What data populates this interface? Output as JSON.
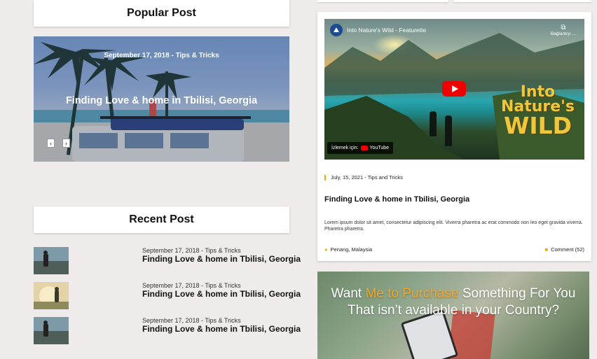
{
  "popular": {
    "heading": "Popular Post",
    "slide": {
      "meta": "September 17, 2018 - Tips & Tricks",
      "title": "Finding Love & home in Tbilisi, Georgia",
      "prev": "‹",
      "next": "›"
    }
  },
  "recent": {
    "heading": "Recent Post",
    "items": [
      {
        "meta": "September 17, 2018 - Tips & Tricks",
        "title": "Finding Love & home in Tbilisi, Georgia"
      },
      {
        "meta": "September 17, 2018 - Tips & Tricks",
        "title": "Finding Love & home in Tbilisi, Georgia"
      },
      {
        "meta": "September 17, 2018 - Tips & Tricks",
        "title": "Finding Love & home in Tbilisi, Georgia"
      }
    ]
  },
  "video_card": {
    "video": {
      "title": "Into Nature's Wild - Featurette",
      "share_label": "Bağlantıyı ...",
      "brand_line1": "Into",
      "brand_line2": "Nature's",
      "brand_line3": "WILD",
      "watch_label": "İzlemek için:",
      "youtube_label": "YouTube"
    },
    "meta": "July, 15, 2021 - Tips and Tricks",
    "title": "Finding Love & home in Tbilisi, Georgia",
    "body": "Lorem ipsum dolor sit amet, consectetur adipiscing elit. Viverra pharetra ac erat commodo non leo eget gravida viverra. Pharetra pharetra.",
    "location": "Penang, Malaysia",
    "comments": "Comment (52)"
  },
  "promo": {
    "text_before": "Want ",
    "text_accent": "Me to Purchase",
    "text_after": " Something For You That isn’t available in your Country?"
  },
  "colors": {
    "accent": "#f0a500",
    "background": "#efebea",
    "youtube_red": "#e00000"
  }
}
